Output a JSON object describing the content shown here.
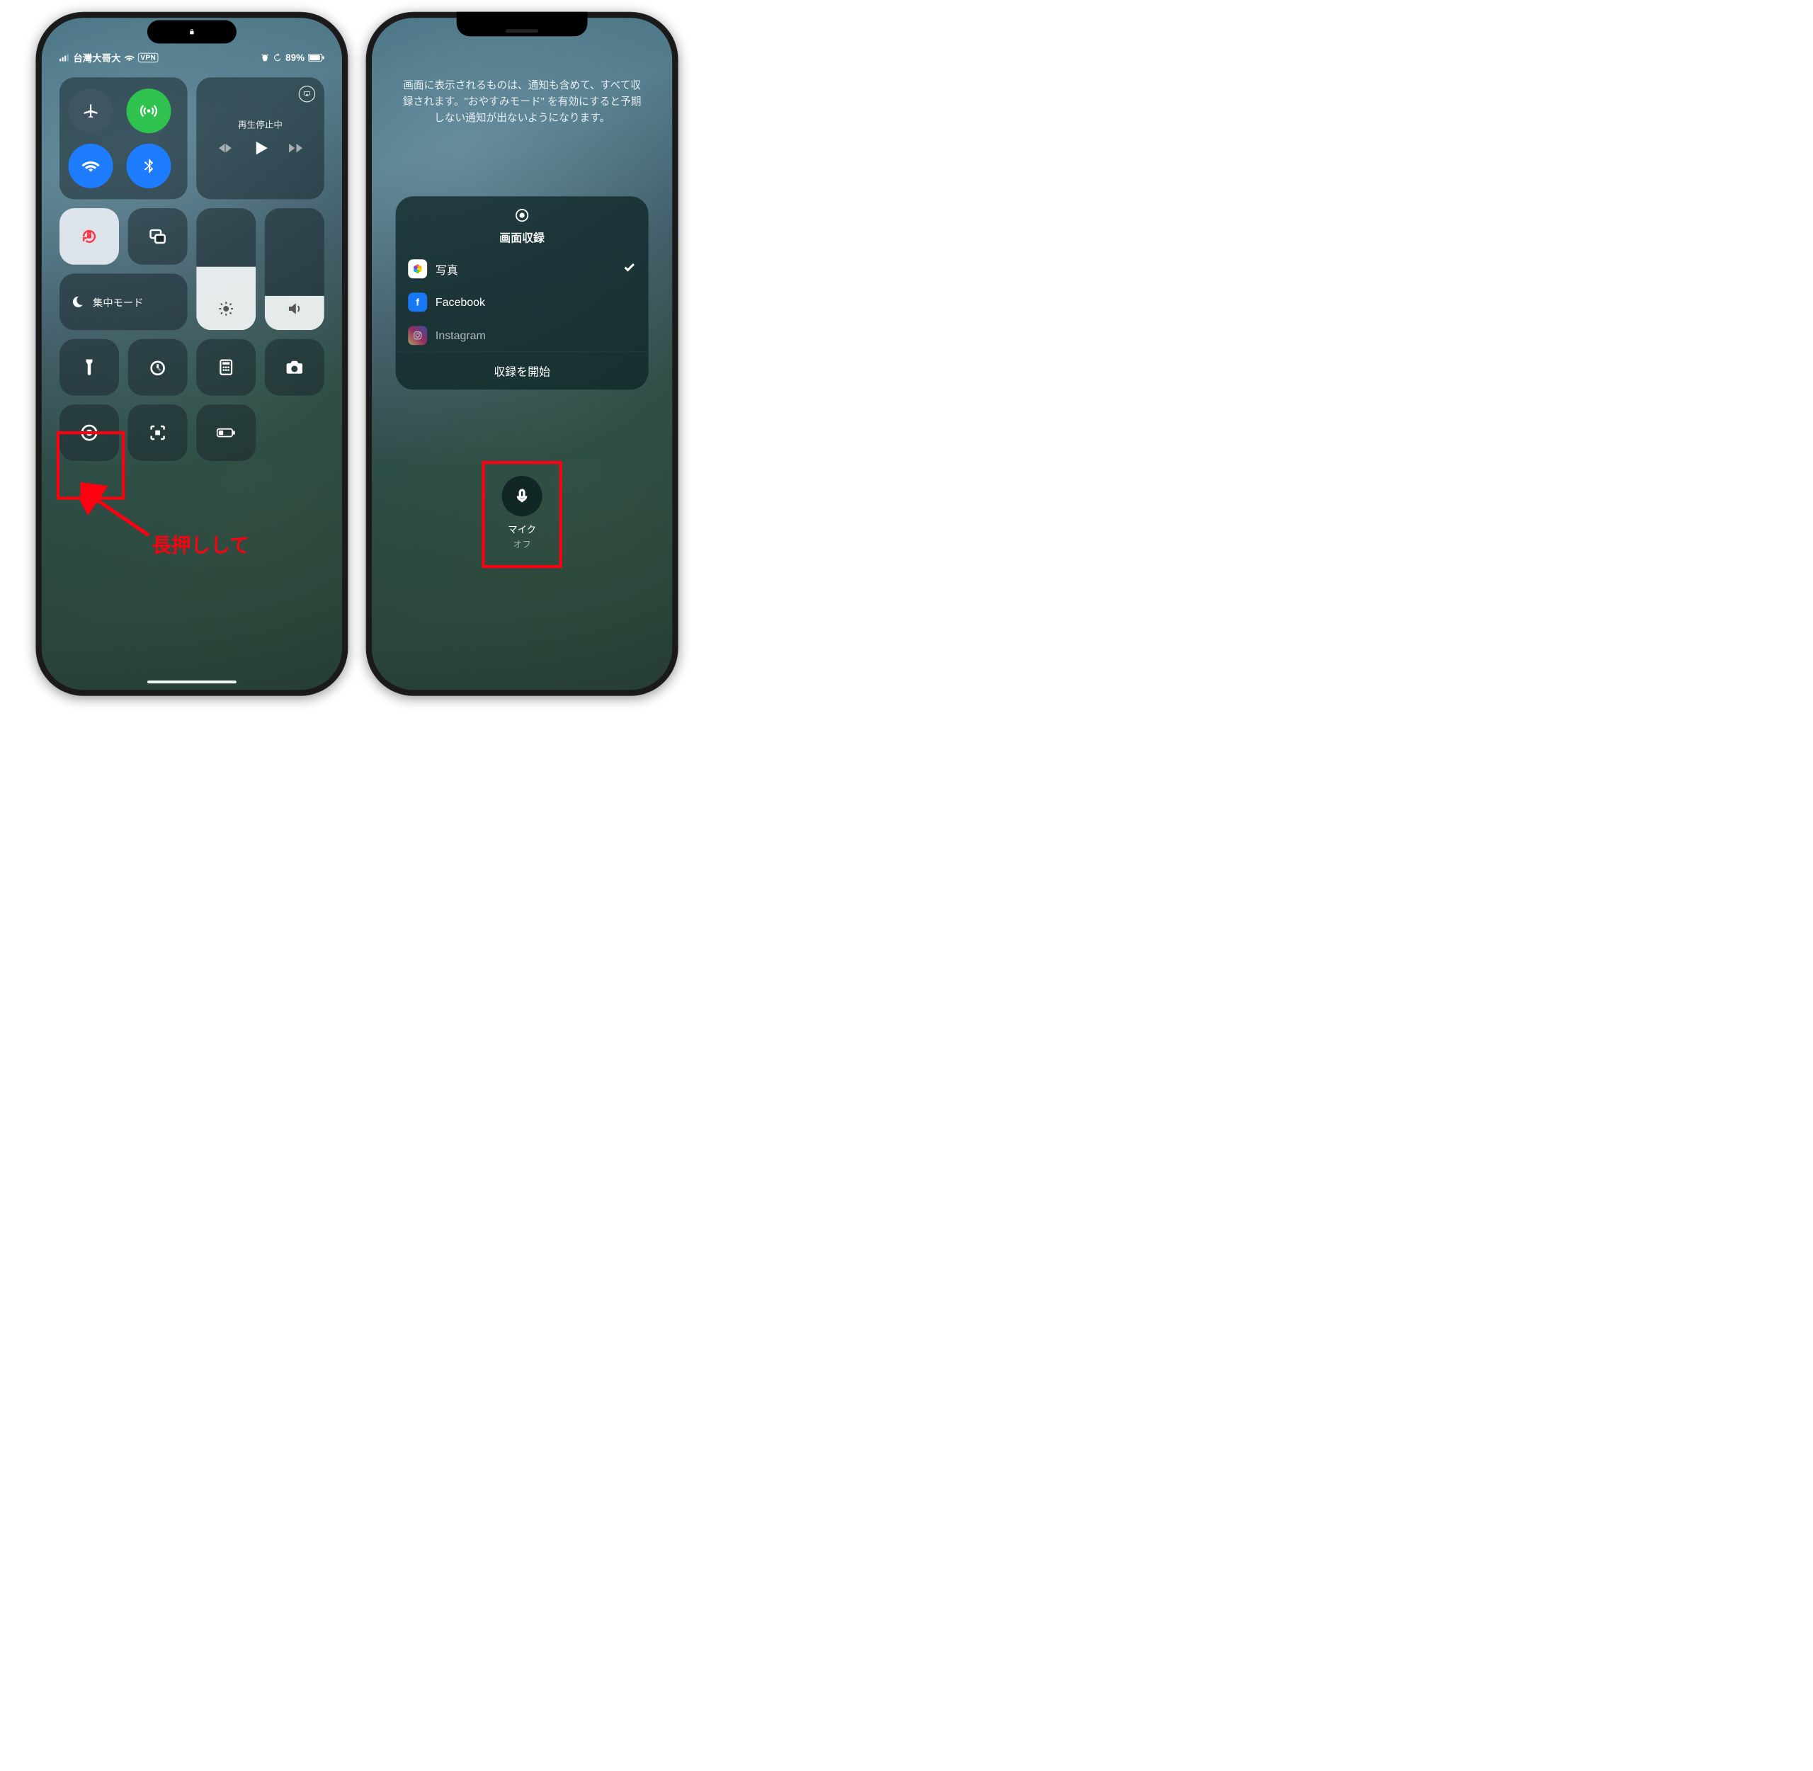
{
  "left": {
    "status": {
      "carrier": "台灣大哥大",
      "vpn": "VPN",
      "battery": "89%"
    },
    "media": {
      "now_playing": "再生停止中"
    },
    "focus_label": "集中モード",
    "icons": {
      "airplane": "airplane-icon",
      "cellular": "cellular-icon",
      "wifi": "wifi-icon",
      "bluetooth": "bluetooth-icon",
      "airplay": "airplay-icon",
      "orientation_lock": "orientation-lock-icon",
      "screen_mirroring": "screen-mirroring-icon",
      "moon": "moon-icon",
      "brightness": "brightness-icon",
      "volume": "volume-icon",
      "flashlight": "flashlight-icon",
      "timer": "timer-icon",
      "calculator": "calculator-icon",
      "camera": "camera-icon",
      "screen_record": "screen-record-icon",
      "qr": "qr-code-icon",
      "low_power": "low-power-icon"
    },
    "annotation": "長押しして"
  },
  "right": {
    "message": "画面に表示されるものは、通知も含めて、すべて収録されます。\"おやすみモード\" を有効にすると予期しない通知が出ないようになります。",
    "panel": {
      "title": "画面収録",
      "apps": [
        {
          "name": "写真",
          "icon": "photos",
          "selected": true
        },
        {
          "name": "Facebook",
          "icon": "facebook",
          "selected": false
        },
        {
          "name": "Instagram",
          "icon": "instagram",
          "selected": false
        }
      ],
      "start": "収録を開始"
    },
    "mic": {
      "label": "マイク",
      "state": "オフ"
    }
  }
}
